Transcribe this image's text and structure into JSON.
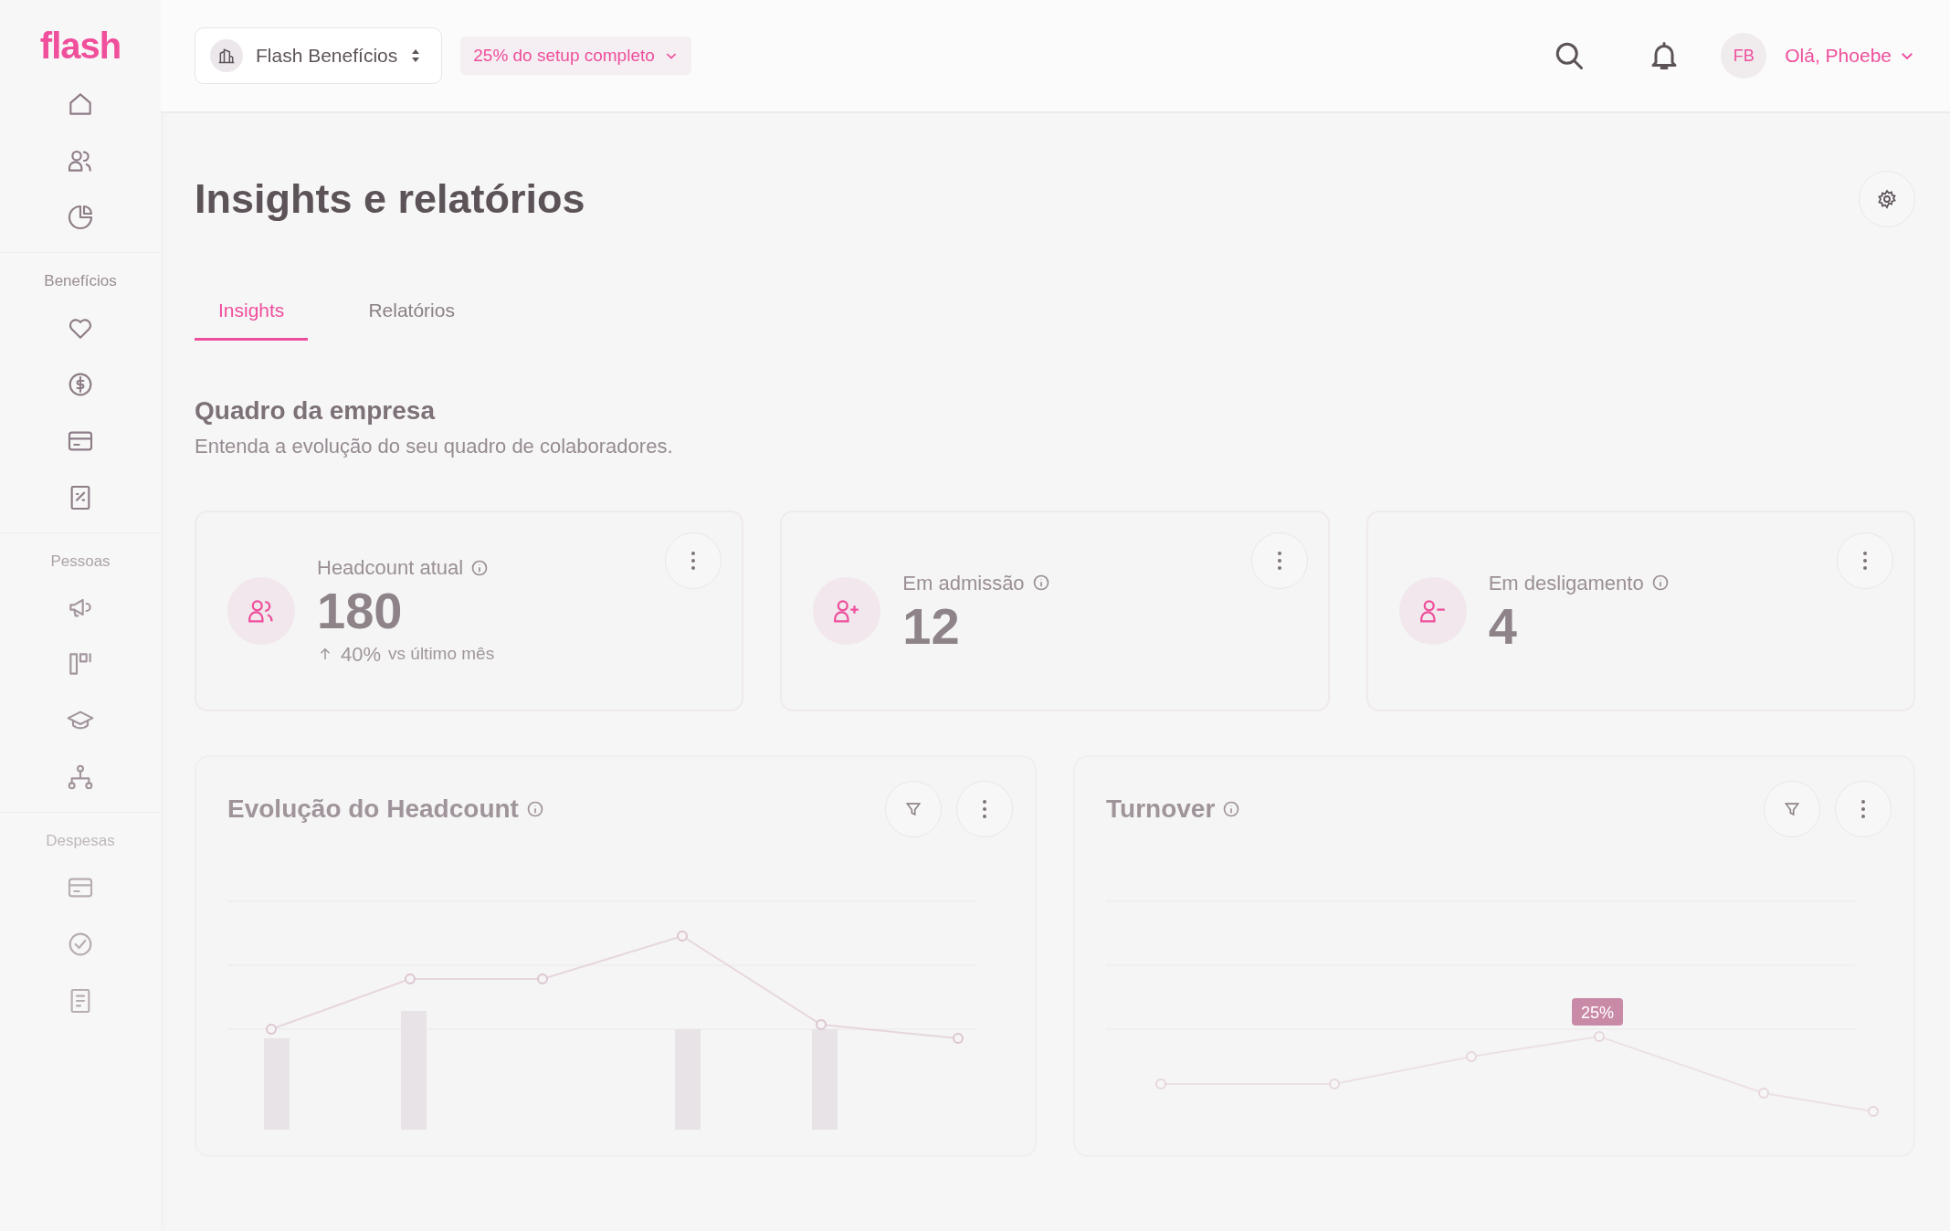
{
  "sidebar": {
    "logo": "flash",
    "sections": [
      {
        "title": "Benefícios"
      },
      {
        "title": "Pessoas"
      },
      {
        "title": "Despesas"
      }
    ]
  },
  "topbar": {
    "company_selector": {
      "label": "Flash Benefícios"
    },
    "setup_progress": {
      "label": "25% do setup completo"
    },
    "user": {
      "initials": "FB",
      "greeting": "Olá, Phoebe"
    }
  },
  "page": {
    "title": "Insights e relatórios",
    "tabs": [
      {
        "label": "Insights",
        "selected": true
      },
      {
        "label": "Relatórios",
        "selected": false
      }
    ],
    "section": {
      "title": "Quadro da empresa",
      "subtitle": "Entenda a evolução do seu quadro de colaboradores."
    },
    "metric_cards": [
      {
        "label": "Headcount atual",
        "value": "180",
        "trend": {
          "change": "40%",
          "comparison": "vs último mês"
        }
      },
      {
        "label": "Em admissão",
        "value": "12"
      },
      {
        "label": "Em desligamento",
        "value": "4"
      }
    ],
    "charts": [
      {
        "title": "Evolução do Headcount",
        "kind": "bar-line"
      },
      {
        "title": "Turnover",
        "kind": "line",
        "point_label": "25%"
      }
    ]
  }
}
